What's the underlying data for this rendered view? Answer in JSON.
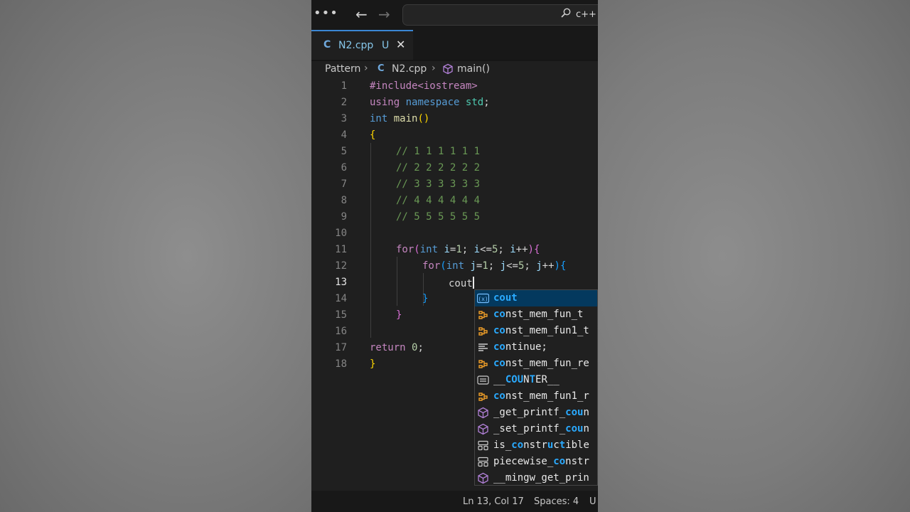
{
  "titlebar": {
    "more_icon": "ellipsis-icon",
    "back_icon": "arrow-left-icon",
    "forward_icon": "arrow-right-icon",
    "search_text": "c++"
  },
  "tab": {
    "icon_text": "C",
    "filename": "N2.cpp",
    "status": "U",
    "close_icon": "close-icon"
  },
  "breadcrumb": {
    "folder": "Pattern",
    "file": "N2.cpp",
    "symbol": "main()"
  },
  "editor": {
    "line_numbers": [
      "1",
      "2",
      "3",
      "4",
      "5",
      "6",
      "7",
      "8",
      "9",
      "10",
      "11",
      "12",
      "13",
      "14",
      "15",
      "16",
      "17",
      "18"
    ],
    "active_line": 13,
    "lines": {
      "l1": "#include<iostream>",
      "l2_kw": "using",
      "l2_ns_kw": "namespace",
      "l2_std": "std",
      "l2_semi": ";",
      "l3_int": "int",
      "l3_main": "main",
      "l3_paren": "()",
      "l4": "{",
      "l5": "// 1 1 1 1 1 1",
      "l6": "// 2 2 2 2 2 2",
      "l7": "// 3 3 3 3 3 3",
      "l8": "// 4 4 4 4 4 4",
      "l9": "// 5 5 5 5 5 5",
      "l11_for": "for",
      "l11_open": "(",
      "l11_int": "int",
      "l11_i": "i",
      "l11_eq": "=",
      "l11_1": "1",
      "l11_s1": "; ",
      "l11_i2": "i",
      "l11_le": "<=",
      "l11_5": "5",
      "l11_s2": "; ",
      "l11_i3": "i",
      "l11_pp": "++",
      "l11_close": ")",
      "l11_brace": "{",
      "l12_for": "for",
      "l12_open": "(",
      "l12_int": "int",
      "l12_j": "j",
      "l12_eq": "=",
      "l12_1": "1",
      "l12_s1": "; ",
      "l12_j2": "j",
      "l12_le": "<=",
      "l12_5": "5",
      "l12_s2": "; ",
      "l12_j3": "j",
      "l12_pp": "++",
      "l12_close": ")",
      "l12_brace": "{",
      "l13": "cout",
      "l14": "}",
      "l15": "}",
      "l17_ret": "return",
      "l17_num": "0",
      "l17_semi": ";",
      "l18": "}"
    }
  },
  "suggestions": [
    {
      "icon": "variable-icon",
      "pre": "",
      "hl": "cout",
      "post": ""
    },
    {
      "icon": "class-icon",
      "pre": "",
      "hl": "co",
      "post": "nst_mem_fun_t"
    },
    {
      "icon": "class-icon",
      "pre": "",
      "hl": "co",
      "post": "nst_mem_fun1_t"
    },
    {
      "icon": "snippet-icon",
      "pre": "",
      "hl": "co",
      "post": "ntinue;"
    },
    {
      "icon": "class-icon",
      "pre": "",
      "hl": "co",
      "post": "nst_mem_fun_re"
    },
    {
      "icon": "macro-icon",
      "pre": "__",
      "hl": "COU",
      "post": "N",
      "hl2": "T",
      "post2": "ER__"
    },
    {
      "icon": "class-icon",
      "pre": "",
      "hl": "co",
      "post": "nst_mem_fun1_r"
    },
    {
      "icon": "method-icon",
      "pre": "_get_printf_",
      "hl": "cou",
      "post": "n"
    },
    {
      "icon": "method-icon",
      "pre": "_set_printf_",
      "hl": "cou",
      "post": "n"
    },
    {
      "icon": "struct-icon",
      "pre": "is_",
      "hl": "co",
      "post": "nstr",
      "hl2": "u",
      "post2": "c",
      "hl3": "t",
      "post3": "ible"
    },
    {
      "icon": "struct-icon",
      "pre": "piecewise_",
      "hl": "co",
      "post": "nstr"
    },
    {
      "icon": "method-icon",
      "pre": "__mingw_get_prin",
      "hl": "",
      "post": ""
    }
  ],
  "statusbar": {
    "position": "Ln 13, Col 17",
    "spaces": "Spaces: 4",
    "encoding": "U"
  },
  "colors": {
    "accent_tab": "#3a86d4",
    "selection": "#04395e",
    "match_highlight": "#2aaaff"
  }
}
